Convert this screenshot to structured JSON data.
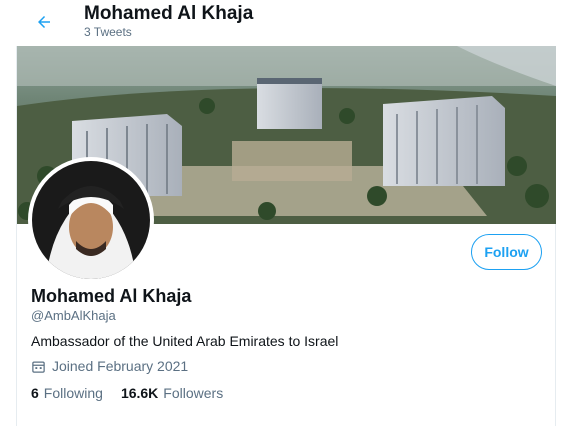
{
  "header": {
    "name": "Mohamed Al Khaja",
    "tweet_count": "3 Tweets",
    "back_icon": "arrow-left-icon"
  },
  "profile": {
    "name": "Mohamed Al Khaja",
    "handle": "@AmbAlKhaja",
    "bio": "Ambassador of the United Arab Emirates to Israel",
    "joined": "Joined February 2021",
    "following_count": "6",
    "following_label": "Following",
    "followers_count": "16.6K",
    "followers_label": "Followers",
    "follow_button": "Follow"
  },
  "colors": {
    "accent": "#1da1f2",
    "text": "#0f1419",
    "muted": "#5b7083"
  }
}
